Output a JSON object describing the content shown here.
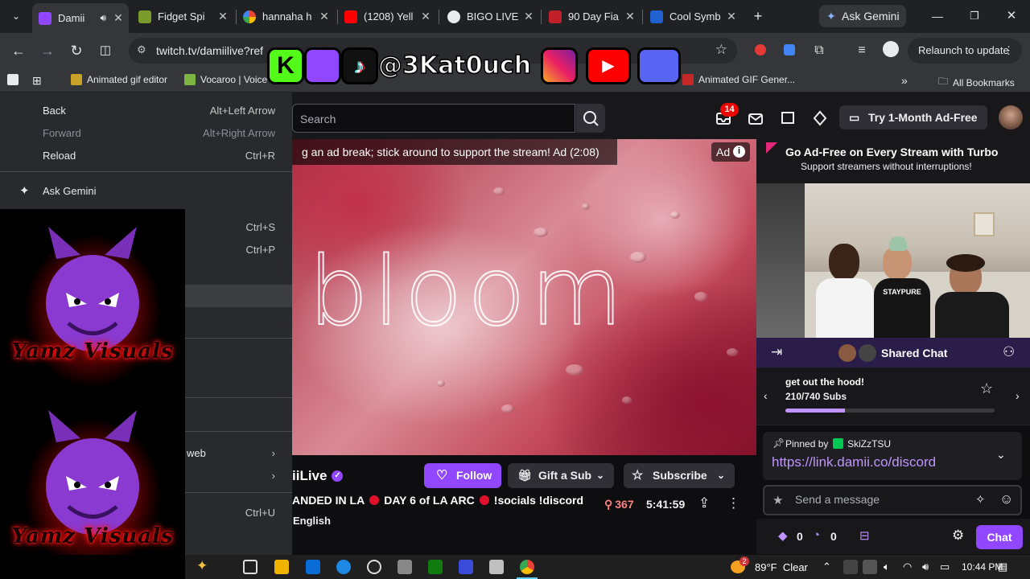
{
  "browser": {
    "tabs": [
      {
        "label": "Damii",
        "active": true
      },
      {
        "label": "Fidget Spi"
      },
      {
        "label": "hannaha h"
      },
      {
        "label": "(1208) Yell"
      },
      {
        "label": "BIGO LIVE"
      },
      {
        "label": "90 Day Fia"
      },
      {
        "label": "Cool Symb"
      }
    ],
    "new_tab": "+",
    "gemini_button": "Ask Gemini",
    "url": "twitch.tv/damiilive?ref",
    "relaunch": "Relaunch to update",
    "bookmarks": [
      {
        "label": "Animated gif editor"
      },
      {
        "label": "Vocaroo | Voice"
      },
      {
        "label": "Animated GIF Gener..."
      }
    ],
    "bookmarks_overflow": "»",
    "all_bookmarks": "All Bookmarks"
  },
  "context_menu": {
    "items": [
      {
        "label": "Back",
        "shortcut": "Alt+Left Arrow"
      },
      {
        "label": "Forward",
        "shortcut": "Alt+Right Arrow",
        "disabled": true
      },
      {
        "label": "Reload",
        "shortcut": "Ctrl+R"
      },
      {
        "label": "Ask Gemini",
        "shortcut": ""
      }
    ],
    "partial_items": [
      {
        "label": "",
        "shortcut": "Ctrl+S"
      },
      {
        "label": "",
        "shortcut": "Ctrl+P"
      },
      {
        "label": "web",
        "submenu": true
      },
      {
        "label": "",
        "submenu": true
      },
      {
        "label": "",
        "shortcut": "Ctrl+U"
      }
    ]
  },
  "overlay": {
    "watermark_1": "Yamz Visuals",
    "watermark_2": "Yamz Visuals",
    "socials_handle": "@3Kat0uch"
  },
  "twitch": {
    "search_placeholder": "Search",
    "notification_count": "14",
    "ad_free_label": "Try 1-Month Ad-Free",
    "ad_banner": "g an ad break; stick around to support the stream! Ad (2:08)",
    "ad_label": "Ad",
    "video_text": "bloom",
    "channel_name": "iiLive",
    "follow": "Follow",
    "gift": "Gift a Sub",
    "subscribe": "Subscribe",
    "title_parts": [
      "ANDED IN LA",
      "DAY 6 of LA ARC",
      "!socials !discord"
    ],
    "viewers": "367",
    "uptime": "5:41:59",
    "language": "English",
    "turbo_title": "Go Ad-Free on Every Stream with Turbo",
    "turbo_sub": "Support streamers without interruptions!",
    "shared_chat": "Shared Chat",
    "goal_text": "get out the hood!",
    "goal_subs": "210/740 Subs",
    "goal_progress": 0.2838,
    "pinned_by": "Pinned by",
    "pinned_user": "SkiZzTSU",
    "pinned_link": "https://link.damii.co/discord",
    "chat_placeholder": "Send a message",
    "points_1": "0",
    "points_2": "0",
    "chat_button": "Chat"
  },
  "taskbar": {
    "weather_badge": "2",
    "weather": "89°F  Clear",
    "time": "10:44 PM"
  },
  "colors": {
    "twitch_purple": "#9147ff",
    "live_red": "#eb0400"
  }
}
